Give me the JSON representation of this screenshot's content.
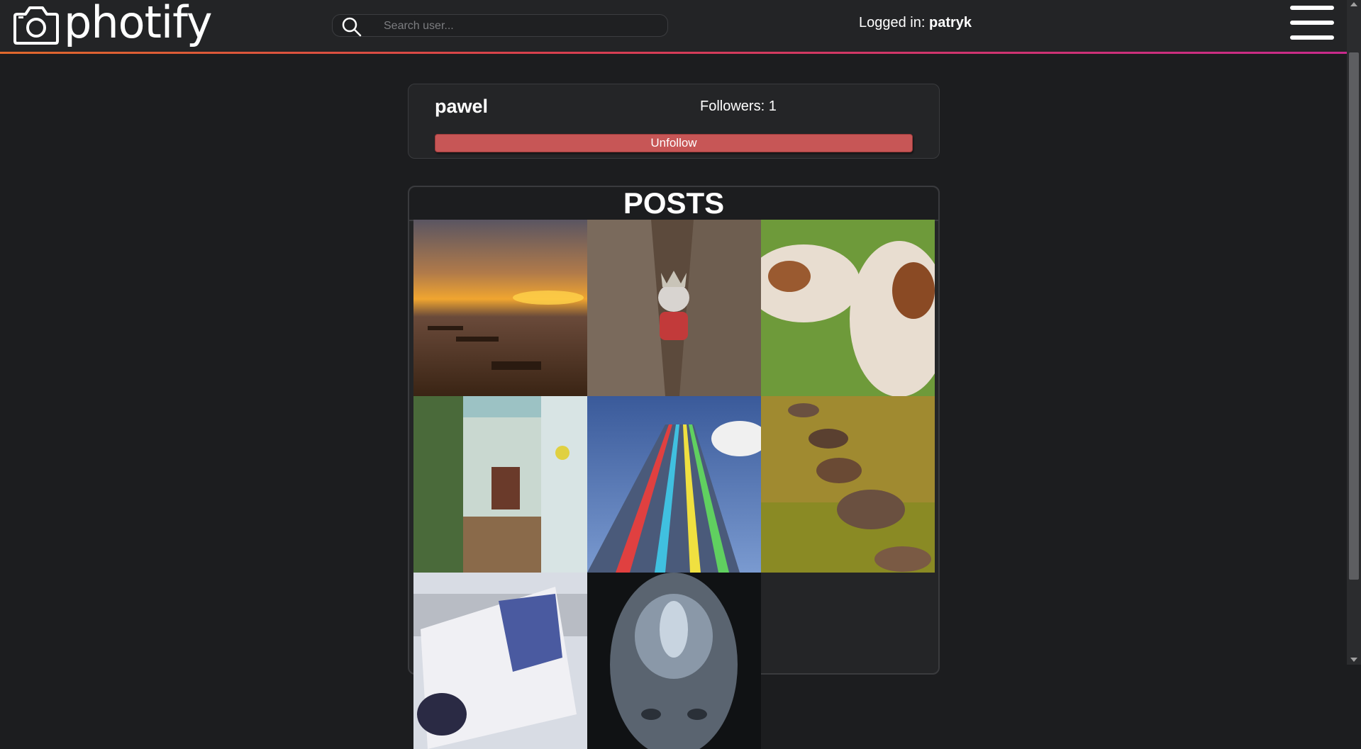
{
  "header": {
    "logo_text": "photify",
    "search": {
      "placeholder": "Search user..."
    },
    "login_label": "Logged in:",
    "login_user": "patryk",
    "menu_icon": "hamburger-menu-icon"
  },
  "profile": {
    "username": "pawel",
    "followers_text": "Followers: 1",
    "unfollow_label": "Unfollow"
  },
  "posts": {
    "title": "POSTS",
    "items": [
      {
        "subject": "sunset over sea with wooden groynes"
      },
      {
        "subject": "mouse figurine with crown in tree trunk"
      },
      {
        "subject": "two cows nuzzling on grass"
      },
      {
        "subject": "greenhouse doorway with chair"
      },
      {
        "subject": "colorful striped tower against blue sky"
      },
      {
        "subject": "mossy stones in shallow water"
      },
      {
        "subject": "blue painted car with graffiti"
      },
      {
        "subject": "fractal mask artwork"
      }
    ]
  },
  "colors": {
    "accent_gradient": [
      "#e0692c",
      "#d8404d",
      "#c92a8c"
    ],
    "unfollow": "#c75656",
    "background": "#1c1d1f"
  }
}
